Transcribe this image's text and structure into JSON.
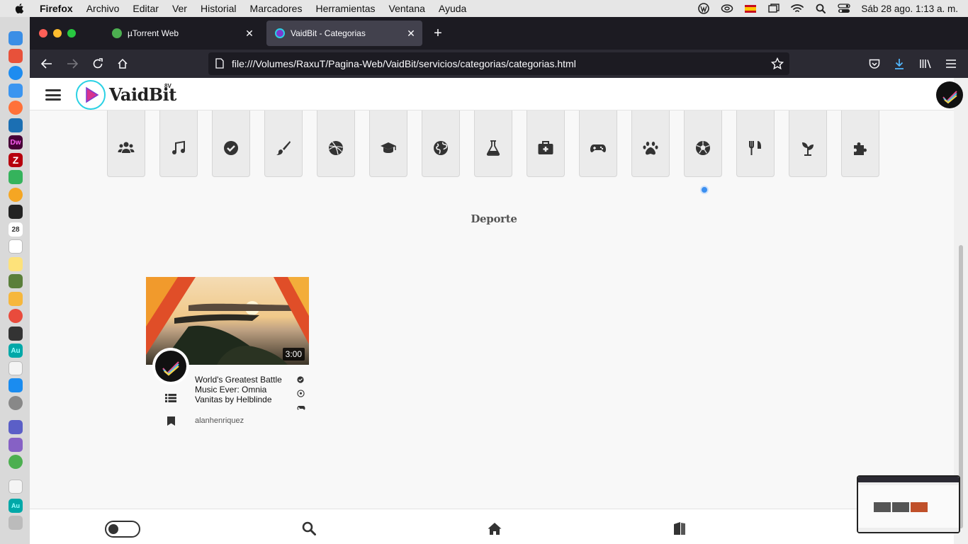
{
  "menubar": {
    "app": "Firefox",
    "items": [
      "Archivo",
      "Editar",
      "Ver",
      "Historial",
      "Marcadores",
      "Herramientas",
      "Ventana",
      "Ayuda"
    ],
    "clock": "Sáb 28 ago.  1:13 a. m."
  },
  "browser": {
    "tabs": [
      {
        "title": "µTorrent Web",
        "active": false
      },
      {
        "title": "VaidBit - Categorias",
        "active": true
      }
    ],
    "url": "file:///Volumes/RaxuT/Pagina-Web/VaidBit/servicios/categorias/categorias.html"
  },
  "site": {
    "logo_text": "VaidBit",
    "logo_sup": "8V",
    "categories": [
      {
        "icon": "users-icon"
      },
      {
        "icon": "music-icon"
      },
      {
        "icon": "check-circle-icon"
      },
      {
        "icon": "paintbrush-icon"
      },
      {
        "icon": "dribbble-icon"
      },
      {
        "icon": "graduation-cap-icon"
      },
      {
        "icon": "globe-icon"
      },
      {
        "icon": "flask-icon"
      },
      {
        "icon": "medkit-icon"
      },
      {
        "icon": "gamepad-icon"
      },
      {
        "icon": "paw-icon"
      },
      {
        "icon": "soccer-ball-icon"
      },
      {
        "icon": "utensils-icon"
      },
      {
        "icon": "seedling-icon"
      },
      {
        "icon": "puzzle-icon"
      }
    ],
    "section_title": "Deporte",
    "video": {
      "duration": "3:00",
      "title": "World's Greatest Battle Music Ever: Omnia Vanitas by Helblinde",
      "author": "alanhenriquez"
    }
  },
  "colors": {
    "accent_cyan": "#2ad1e4",
    "accent_magenta": "#d6338f",
    "tab_bar": "#1c1b22",
    "selected_dot": "#3b8ff0"
  }
}
